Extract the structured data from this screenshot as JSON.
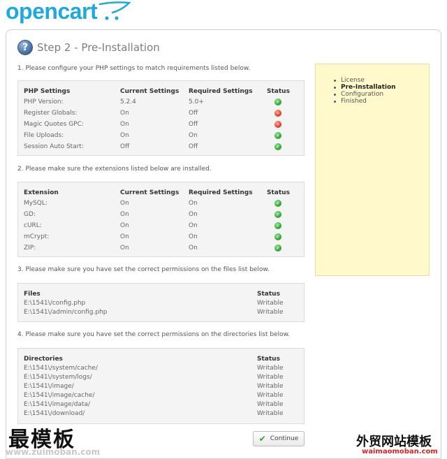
{
  "logo": {
    "text": "opencart"
  },
  "page": {
    "title": "Step 2 - Pre-Installation"
  },
  "sidebar": {
    "steps": [
      {
        "label": "License",
        "active": false
      },
      {
        "label": "Pre-Installation",
        "active": true
      },
      {
        "label": "Configuration",
        "active": false
      },
      {
        "label": "Finished",
        "active": false
      }
    ]
  },
  "php": {
    "intro": "1. Please configure your PHP settings to match requirements listed below.",
    "headers": [
      "PHP Settings",
      "Current Settings",
      "Required Settings",
      "Status"
    ],
    "rows": [
      {
        "name": "PHP Version:",
        "current": "5.2.4",
        "required": "5.0+",
        "status": "ok"
      },
      {
        "name": "Register Globals:",
        "current": "On",
        "required": "Off",
        "status": "bad"
      },
      {
        "name": "Magic Quotes GPC:",
        "current": "On",
        "required": "Off",
        "status": "bad"
      },
      {
        "name": "File Uploads:",
        "current": "On",
        "required": "On",
        "status": "ok"
      },
      {
        "name": "Session Auto Start:",
        "current": "Off",
        "required": "Off",
        "status": "ok"
      }
    ]
  },
  "ext": {
    "intro": "2. Please make sure the extensions listed below are installed.",
    "headers": [
      "Extension",
      "Current Settings",
      "Required Settings",
      "Status"
    ],
    "rows": [
      {
        "name": "MySQL:",
        "current": "On",
        "required": "On",
        "status": "ok"
      },
      {
        "name": "GD:",
        "current": "On",
        "required": "On",
        "status": "ok"
      },
      {
        "name": "cURL:",
        "current": "On",
        "required": "On",
        "status": "ok"
      },
      {
        "name": "mCrypt:",
        "current": "On",
        "required": "On",
        "status": "ok"
      },
      {
        "name": "ZIP:",
        "current": "On",
        "required": "On",
        "status": "ok"
      }
    ]
  },
  "files": {
    "intro": "3. Please make sure you have set the correct permissions on the files list below.",
    "headers": [
      "Files",
      "Status"
    ],
    "rows": [
      {
        "path": "E:\\1541\\/config.php",
        "status": "Writable"
      },
      {
        "path": "E:\\1541\\/admin/config.php",
        "status": "Writable"
      }
    ]
  },
  "dirs": {
    "intro": "4. Please make sure you have set the correct permissions on the directories list below.",
    "headers": [
      "Directories",
      "Status"
    ],
    "rows": [
      {
        "path": "E:\\1541\\/system/cache/",
        "status": "Writable"
      },
      {
        "path": "E:\\1541\\/system/logs/",
        "status": "Writable"
      },
      {
        "path": "E:\\1541\\/image/",
        "status": "Writable"
      },
      {
        "path": "E:\\1541\\/image/cache/",
        "status": "Writable"
      },
      {
        "path": "E:\\1541\\/image/data/",
        "status": "Writable"
      },
      {
        "path": "E:\\1541\\/download/",
        "status": "Writable"
      }
    ]
  },
  "buttons": {
    "continue": "Continue"
  },
  "watermark": {
    "left_text": "最模板",
    "left_url": "www.zuimoban.com",
    "right_text": "外贸网站模板",
    "right_url": "waimaomoban.com"
  },
  "colors": {
    "brand": "#1fa9dc",
    "sidebar_bg": "#fff9cc",
    "ok": "#2ea12e",
    "bad": "#d83a24"
  }
}
